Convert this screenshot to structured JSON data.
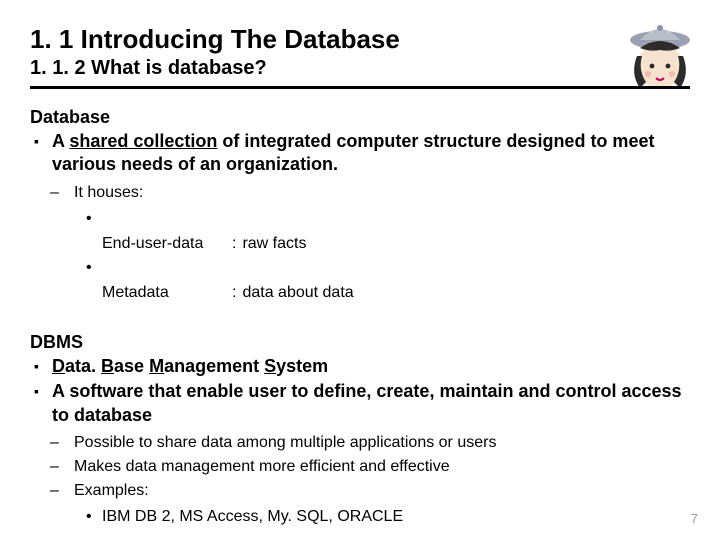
{
  "header": {
    "title": "1. 1 Introducing The Database",
    "subtitle": "1. 1. 2 What is database?"
  },
  "section_db": {
    "heading": "Database",
    "definition_html": "A <span class=\"u\">shared collection</span> of integrated computer structure designed to meet various needs of an organization.",
    "houses_label": "It houses:",
    "items": [
      {
        "key": "End-user-data",
        "sep": ":",
        "val": "raw facts"
      },
      {
        "key": "Metadata",
        "sep": ":",
        "val": "data about data"
      }
    ]
  },
  "section_dbms": {
    "heading": "DBMS",
    "bullets_html": [
      "<span class=\"u\">D</span>ata. <span class=\"u\">B</span>ase <span class=\"u\">M</span>anagement <span class=\"u\">S</span>ystem",
      "A software that enable user to define, create, maintain and control access to database"
    ],
    "sub": {
      "lines": [
        "Possible to share data among multiple applications or users",
        "Makes data management more efficient and effective",
        "Examples:"
      ],
      "examples": "IBM DB 2, MS Access, My. SQL, ORACLE"
    }
  },
  "page_number": "7"
}
